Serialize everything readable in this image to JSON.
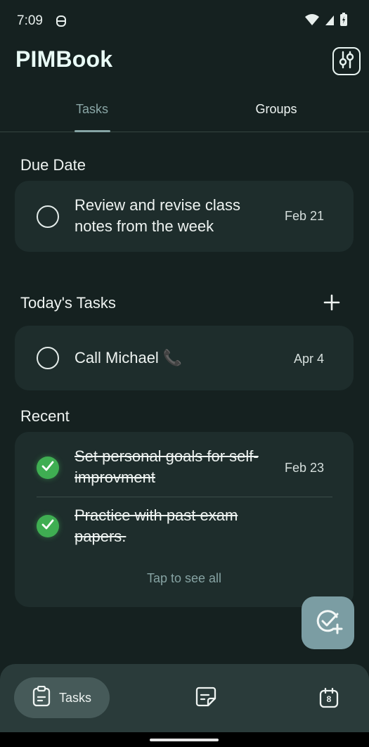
{
  "status_bar": {
    "time": "7:09"
  },
  "app": {
    "title": "PIMBook"
  },
  "tabs": [
    {
      "label": "Tasks"
    },
    {
      "label": "Groups"
    }
  ],
  "due_date": {
    "title": "Due Date",
    "tasks": [
      {
        "text": "Review and revise class notes from the week",
        "date": "Feb 21"
      }
    ]
  },
  "today": {
    "title": "Today's Tasks",
    "tasks": [
      {
        "text": "Call Michael 📞",
        "date": "Apr 4"
      }
    ]
  },
  "recent": {
    "title": "Recent",
    "tasks": [
      {
        "text": "Set personal goals for self-improvment",
        "date": "Feb 23",
        "done": true
      },
      {
        "text": "Practice with past exam papers.",
        "date": "",
        "done": true
      }
    ],
    "see_all": "Tap to see all"
  },
  "bottom_nav": {
    "items": [
      {
        "label": "Tasks",
        "icon": "clipboard-icon",
        "active": true
      },
      {
        "label": "",
        "icon": "note-icon",
        "active": false
      },
      {
        "label": "",
        "icon": "calendar-icon",
        "badge": "8",
        "active": false
      }
    ]
  },
  "colors": {
    "background": "#152120",
    "card": "#1e2d2c",
    "accent": "#86a4a4",
    "check": "#3fae52",
    "fab": "#7b9da3"
  }
}
